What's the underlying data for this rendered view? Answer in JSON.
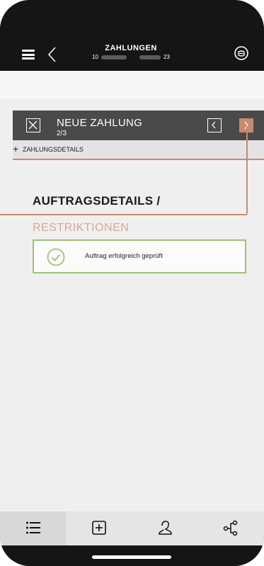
{
  "topbar": {
    "title": "ZAHLUNGEN",
    "subtitle_prefix": "10",
    "subtitle_suffix": "23"
  },
  "header": {
    "title": "NEUE ZAHLUNG",
    "step": "2/3"
  },
  "details_row": {
    "plus": "+",
    "label": "ZAHLUNGSDETAILS"
  },
  "section": {
    "title": "AUFTRAGSDETAILS /",
    "subtitle": "RESTRIKTIONEN"
  },
  "status": {
    "message": "Auftrag erfolgreich geprüft"
  },
  "tabbar": {
    "tabs": [
      {
        "icon": "list-icon"
      },
      {
        "icon": "add-box-icon"
      },
      {
        "icon": "person-icon"
      },
      {
        "icon": "share-icon"
      }
    ]
  },
  "colors": {
    "accent": "#c98b6b",
    "success": "#9cc46c",
    "dark": "#151515"
  }
}
